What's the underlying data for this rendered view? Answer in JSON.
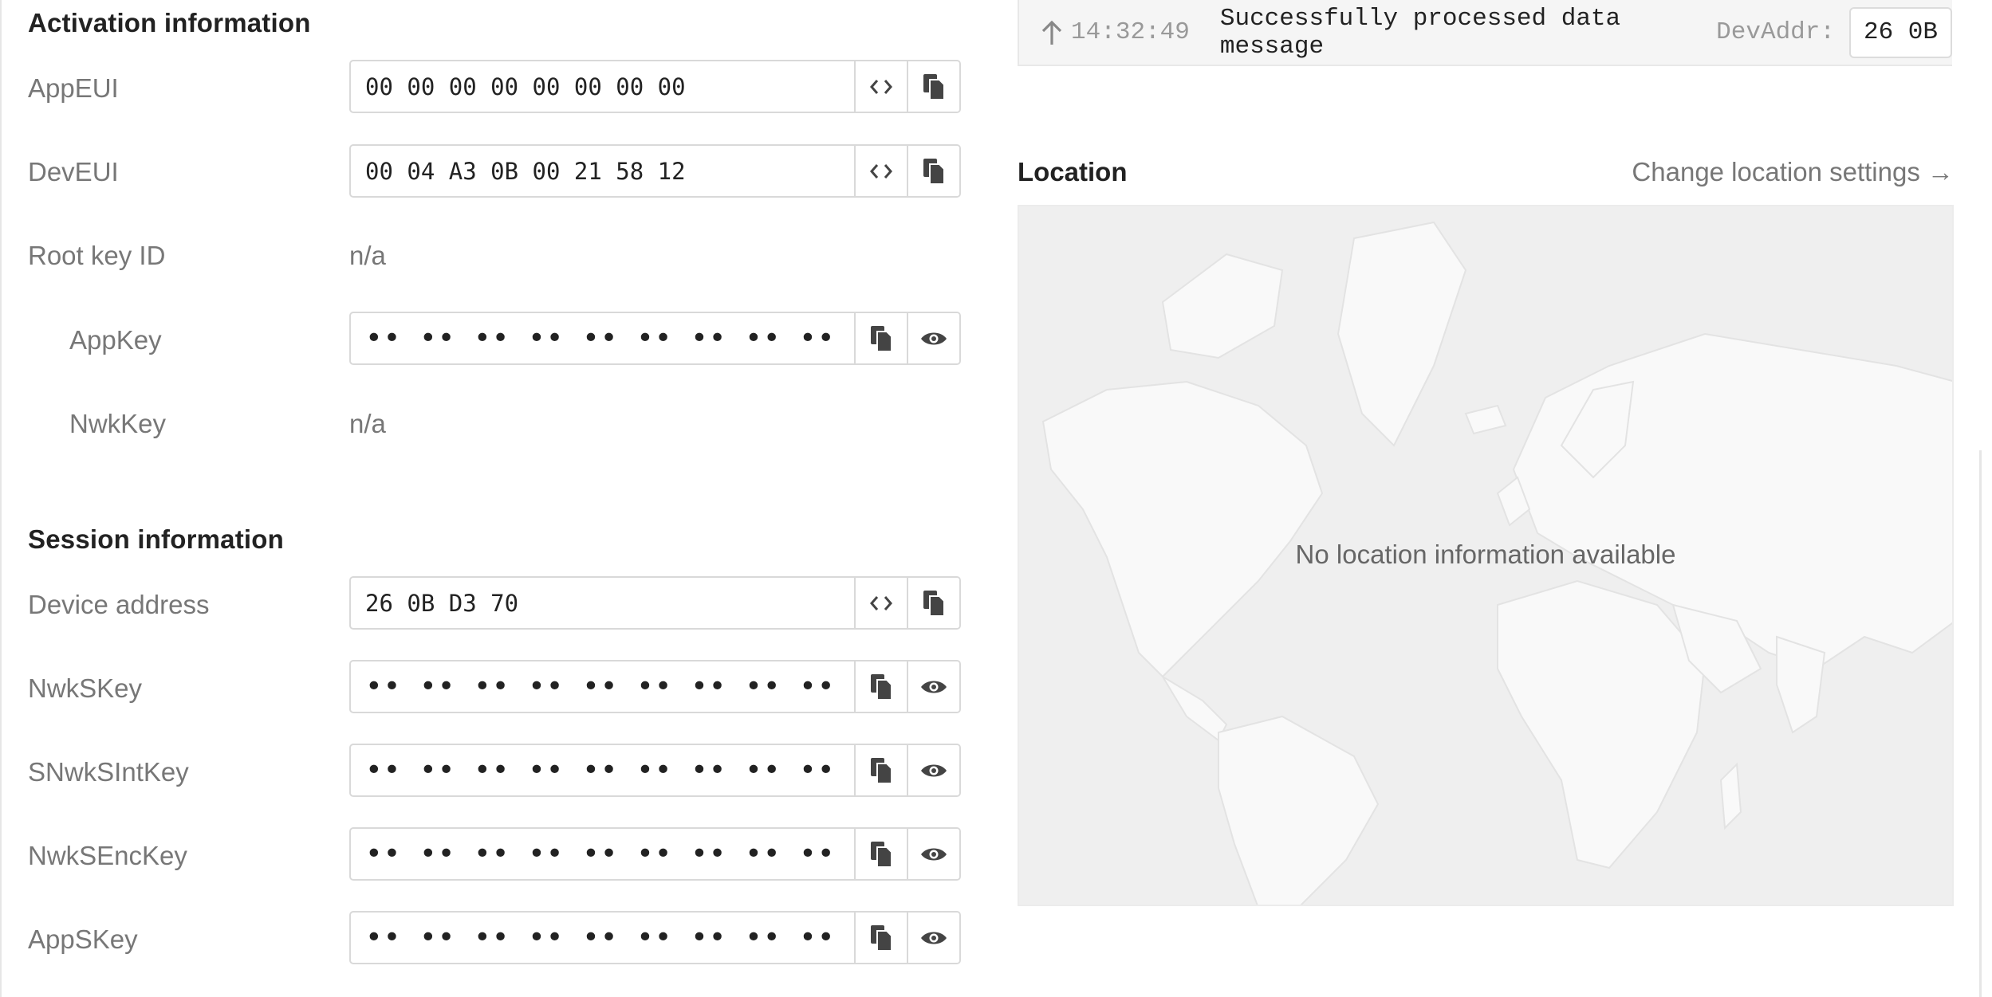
{
  "activation": {
    "title": "Activation information",
    "appeui": {
      "label": "AppEUI",
      "value": "00 00 00 00 00 00 00 00"
    },
    "deveui": {
      "label": "DevEUI",
      "value": "00 04 A3 0B 00 21 58 12"
    },
    "root_key_id": {
      "label": "Root key ID",
      "value": "n/a"
    },
    "appkey": {
      "label": "AppKey",
      "value": "•• •• •• •• •• •• •• •• •• •• •• •• •• •• •• ••"
    },
    "nwkkey": {
      "label": "NwkKey",
      "value": "n/a"
    }
  },
  "session": {
    "title": "Session information",
    "device_address": {
      "label": "Device address",
      "value": "26 0B D3 70"
    },
    "nwkskey": {
      "label": "NwkSKey",
      "value": "•• •• •• •• •• •• •• •• •• •• •• •• •• •• •• ••"
    },
    "snwksintkey": {
      "label": "SNwkSIntKey",
      "value": "•• •• •• •• •• •• •• •• •• •• •• •• •• •• •• ••"
    },
    "nwksenckey": {
      "label": "NwkSEncKey",
      "value": "•• •• •• •• •• •• •• •• •• •• •• •• •• •• •• ••"
    },
    "appskey": {
      "label": "AppSKey",
      "value": "•• •• •• •• •• •• •• •• •• •• •• •• •• •• •• ••"
    }
  },
  "event": {
    "time": "14:32:49",
    "message": "Successfully processed data message",
    "devaddr_key": "DevAddr:",
    "devaddr_value": "26 0B"
  },
  "location": {
    "title": "Location",
    "change_link": "Change location settings →",
    "empty_message": "No location information available"
  },
  "icons": {
    "byte_order": "code-icon",
    "copy": "copy-icon",
    "show": "eye-icon",
    "uplink": "arrow-up-icon"
  },
  "colors": {
    "label": "#777777",
    "map_background": "#efefef",
    "land": "#f9f9f9"
  }
}
